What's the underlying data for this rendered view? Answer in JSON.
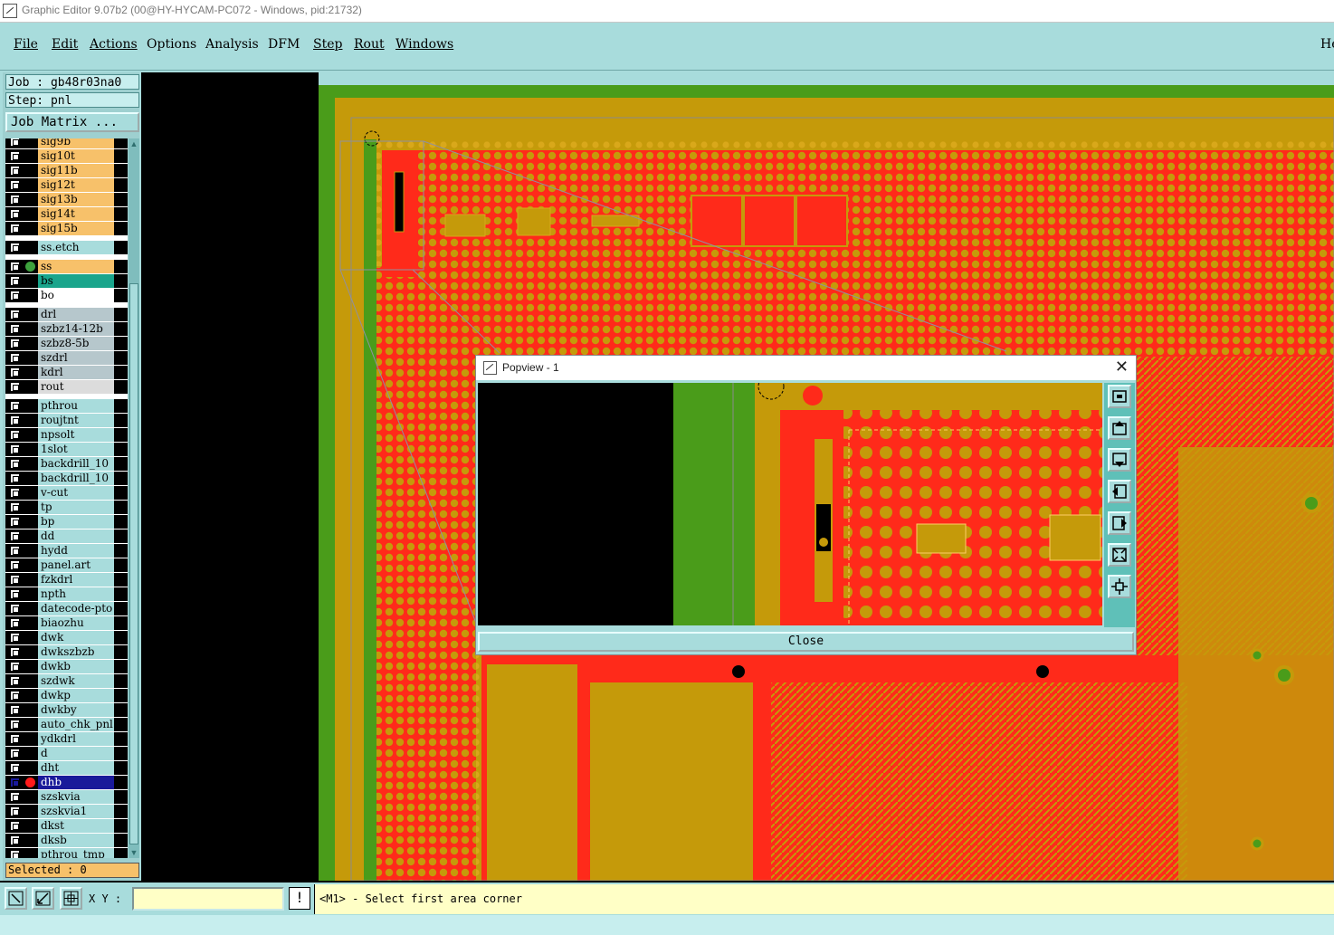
{
  "window": {
    "title": "Graphic Editor 9.07b2 (00@HY-HYCAM-PC072 - Windows, pid:21732)"
  },
  "menu": [
    {
      "label": "File"
    },
    {
      "label": "Edit"
    },
    {
      "label": "Actions"
    },
    {
      "label": "Options"
    },
    {
      "label": "Analysis"
    },
    {
      "label": "DFM"
    },
    {
      "label": "Step"
    },
    {
      "label": "Rout"
    },
    {
      "label": "Windows"
    },
    {
      "label": "He"
    }
  ],
  "left_panel": {
    "job": "Job : gb48r03na0",
    "step": "Step: pnl",
    "job_matrix_button": "Job Matrix ...",
    "selected": "Selected : 0",
    "layers": [
      {
        "name": "sig9b",
        "color": "#f7c16a"
      },
      {
        "name": "sig10t",
        "color": "#f7c16a"
      },
      {
        "name": "sig11b",
        "color": "#f7c16a"
      },
      {
        "name": "sig12t",
        "color": "#f7c16a"
      },
      {
        "name": "sig13b",
        "color": "#f7c16a"
      },
      {
        "name": "sig14t",
        "color": "#f7c16a"
      },
      {
        "name": "sig15b",
        "color": "#f7c16a"
      },
      {
        "name": "ss.etch",
        "color": "#a8dcdc",
        "gap_before": true
      },
      {
        "name": "ss",
        "color": "#f7c16a",
        "gap_before": true,
        "dot": "#3da23d"
      },
      {
        "name": "bs",
        "color": "#1aa58c"
      },
      {
        "name": "bo",
        "color": "#ffffff"
      },
      {
        "name": "drl",
        "color": "#b6c7cc",
        "gap_before": true
      },
      {
        "name": "szbz14-12b",
        "color": "#b6c7cc"
      },
      {
        "name": "szbz8-5b",
        "color": "#b6c7cc"
      },
      {
        "name": "szdrl",
        "color": "#b6c7cc"
      },
      {
        "name": "kdrl",
        "color": "#b6c7cc"
      },
      {
        "name": "rout",
        "color": "#dcdcdc"
      },
      {
        "name": "pthrou",
        "color": "#a8dcdc",
        "gap_before": true
      },
      {
        "name": "roujtnt",
        "color": "#a8dcdc"
      },
      {
        "name": "npsolt",
        "color": "#a8dcdc"
      },
      {
        "name": "1slot",
        "color": "#a8dcdc"
      },
      {
        "name": "backdrill_10",
        "color": "#a8dcdc"
      },
      {
        "name": "backdrill_10",
        "color": "#a8dcdc"
      },
      {
        "name": "v-cut",
        "color": "#a8dcdc"
      },
      {
        "name": "tp",
        "color": "#a8dcdc"
      },
      {
        "name": "bp",
        "color": "#a8dcdc"
      },
      {
        "name": "dd",
        "color": "#a8dcdc"
      },
      {
        "name": "hydd",
        "color": "#a8dcdc"
      },
      {
        "name": "panel.art",
        "color": "#a8dcdc"
      },
      {
        "name": "fzkdrl",
        "color": "#a8dcdc"
      },
      {
        "name": "npth",
        "color": "#a8dcdc"
      },
      {
        "name": "datecode-pto",
        "color": "#a8dcdc"
      },
      {
        "name": "biaozhu",
        "color": "#a8dcdc"
      },
      {
        "name": "dwk",
        "color": "#a8dcdc"
      },
      {
        "name": "dwkszbzb",
        "color": "#a8dcdc"
      },
      {
        "name": "dwkb",
        "color": "#a8dcdc"
      },
      {
        "name": "szdwk",
        "color": "#a8dcdc"
      },
      {
        "name": "dwkp",
        "color": "#a8dcdc"
      },
      {
        "name": "dwkby",
        "color": "#a8dcdc"
      },
      {
        "name": "auto_chk_pnl",
        "color": "#a8dcdc"
      },
      {
        "name": "ydkdrl",
        "color": "#a8dcdc"
      },
      {
        "name": "d",
        "color": "#a8dcdc"
      },
      {
        "name": "dht",
        "color": "#a8dcdc"
      },
      {
        "name": "dhb",
        "color": "#1a1a9a",
        "dot": "#ff1a1a",
        "active": true
      },
      {
        "name": "szskvia",
        "color": "#a8dcdc"
      },
      {
        "name": "szskvia1",
        "color": "#a8dcdc"
      },
      {
        "name": "dkst",
        "color": "#a8dcdc"
      },
      {
        "name": "dksb",
        "color": "#a8dcdc"
      },
      {
        "name": "pthrou_tmp",
        "color": "#a8dcdc"
      }
    ]
  },
  "canvas_colors": {
    "background": "#000000",
    "panel": "#4a9c1a",
    "copper": "#c59a0a",
    "signal": "#ff2a1a"
  },
  "popview": {
    "title": "Popview - 1",
    "close_label": "Close",
    "tools": [
      "zoom-window-icon",
      "pan-up-icon",
      "pan-down-icon",
      "pan-left-icon",
      "pan-right-icon",
      "zoom-out-icon",
      "fit-all-icon"
    ]
  },
  "bottom": {
    "xy_label": "X Y :",
    "xy_value": "",
    "warn_label": "!",
    "status": "<M1> - Select first area corner"
  }
}
